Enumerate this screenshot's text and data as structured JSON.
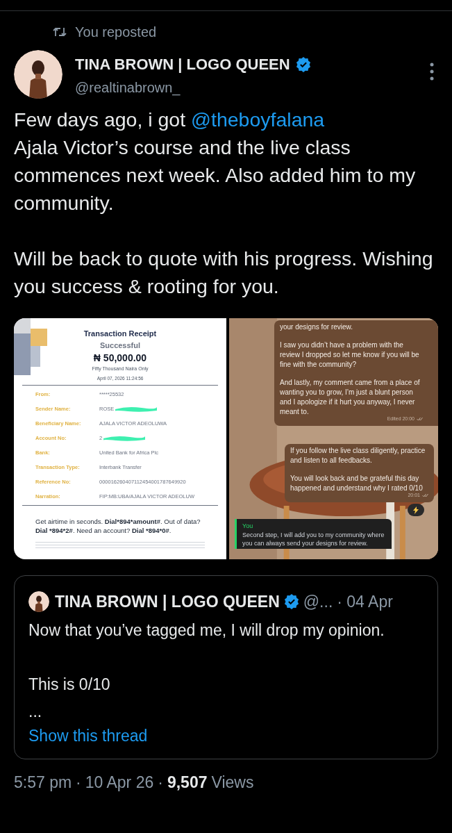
{
  "repost": {
    "label": "You reposted"
  },
  "author": {
    "name": "TINA BROWN | LOGO QUEEN",
    "handle": "@realtinabrown_",
    "verified": true
  },
  "body": [
    [
      {
        "kind": "text",
        "text": "Few days ago, i got "
      },
      {
        "kind": "mention",
        "text": "@theboyfalana"
      },
      {
        "kind": "break"
      },
      {
        "kind": "text",
        "text": "Ajala Victor’s course and the live class commences next week. Also added him to my community."
      }
    ],
    [
      {
        "kind": "text",
        "text": "Will be back to quote with his progress. Wishing you success & rooting for you."
      }
    ]
  ],
  "media": [
    {
      "kind": "receipt",
      "title": "Transaction Receipt",
      "status": "Successful",
      "amount": "₦ 50,000.00",
      "amount_words": "Fifty Thousand Naira Only",
      "datetime": "April 07, 2026 11:24:56",
      "fields": [
        {
          "label": "From:",
          "value": "*****25532",
          "redacted": false
        },
        {
          "label": "Sender Name:",
          "value": "ROSE",
          "redacted": true
        },
        {
          "label": "Beneficiary Name:",
          "value": "AJALA VICTOR ADEOLUWA",
          "redacted": false
        },
        {
          "label": "Account No:",
          "value": "2",
          "redacted": true
        },
        {
          "label": "Bank:",
          "value": "United Bank for Africa Plc",
          "redacted": false
        },
        {
          "label": "Transaction Type:",
          "value": "Interbank Transfer",
          "redacted": false
        },
        {
          "label": "Reference No:",
          "value": "000016260407112454001787649920",
          "redacted": false
        },
        {
          "label": "Narration:",
          "value": "FIP:MB:UBA/AJALA VICTOR ADEOLUW",
          "redacted": false
        }
      ],
      "promo": "Get airtime in seconds. **Dial*894*amount#**. Out of data? **Dial *894*2#**. Need an account? **Dial *894*0#**."
    },
    {
      "kind": "chat",
      "messages": [
        {
          "kind": "incoming",
          "paragraphs": [
            "your designs for review.",
            "I saw you didn’t have a problem with the review I dropped so let me know if you will be fine with the community?",
            "And lastly, my comment came from a place of wanting you to grow, I’m just a blunt person and I apologize if it hurt you anyway, I never meant to."
          ],
          "time": "Edited 20:00"
        },
        {
          "kind": "incoming",
          "paragraphs": [
            "If you follow the live class diligently, practice and listen to all feedbacks.",
            "You will look back and be grateful this day happened and understand why I rated 0/10"
          ],
          "time": "20:01"
        },
        {
          "kind": "reply",
          "sender": "You",
          "paragraphs": [
            "Second step, I will add you to my community where you can always send your designs for review."
          ]
        }
      ]
    }
  ],
  "quote": {
    "name": "TINA BROWN | LOGO QUEEN",
    "verified": true,
    "handle": "@...",
    "date": "· 04 Apr",
    "paragraphs": [
      "Now that you’ve tagged me, I will drop my opinion.",
      "This is 0/10",
      "..."
    ],
    "link": "Show this thread"
  },
  "meta": {
    "time": "5:57 pm",
    "separator_1": "·",
    "date": "10 Apr 26",
    "separator_2": "·",
    "views_count": "9,507",
    "views_label": "Views"
  }
}
